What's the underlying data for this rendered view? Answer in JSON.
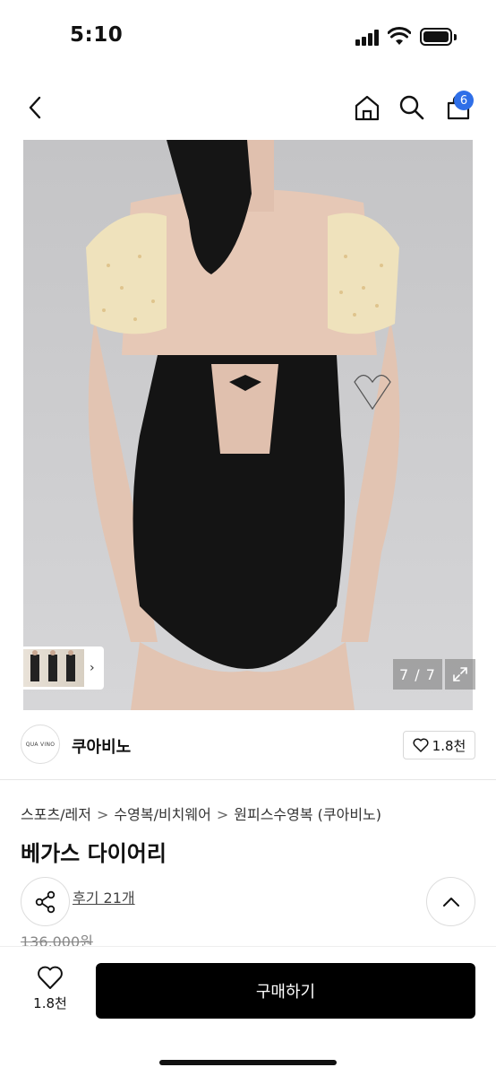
{
  "status_bar": {
    "time": "5:10"
  },
  "nav": {
    "cart_count": "6"
  },
  "gallery": {
    "counter": "7 / 7"
  },
  "shop": {
    "logo_text": "QUA VINO",
    "name": "쿠아비노",
    "like_count": "1.8천"
  },
  "product": {
    "breadcrumb": [
      "스포츠/레저",
      "수영복/비치웨어",
      "원피스수영복 (쿠아비노)"
    ],
    "title": "베가스 다이어리",
    "review_link": "후기 21개",
    "original_price": "136,000원"
  },
  "bottom_bar": {
    "wish_count": "1.8천",
    "buy_label": "구매하기"
  },
  "colors": {
    "accent": "#2f6fe8",
    "buy_button": "#000000"
  }
}
